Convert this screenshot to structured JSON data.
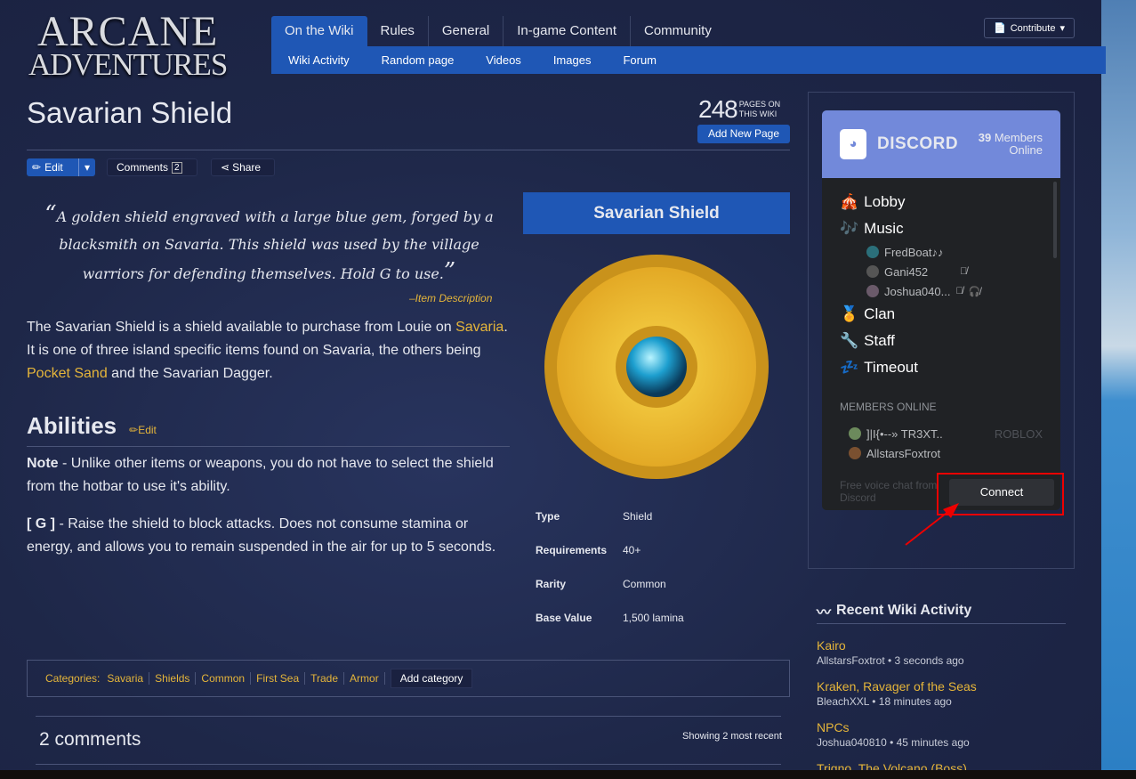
{
  "logo": {
    "line1": "ARCANE",
    "line2": "ADVENTURES"
  },
  "nav": {
    "tabs": [
      "On the Wiki",
      "Rules",
      "General",
      "In-game Content",
      "Community"
    ],
    "subtabs": [
      "Wiki Activity",
      "Random page",
      "Videos",
      "Images",
      "Forum"
    ]
  },
  "contribute": "Contribute",
  "page": {
    "title": "Savarian Shield",
    "count": "248",
    "count_label1": "PAGES ON",
    "count_label2": "THIS WIKI",
    "add_page": "Add New Page"
  },
  "actions": {
    "edit": "Edit",
    "comments": "Comments",
    "comments_count": "2",
    "share": "Share"
  },
  "quote": {
    "text": "A golden shield engraved with a large blue gem, forged by a blacksmith on Savaria. This shield was used by the village warriors for defending themselves. Hold G to use.",
    "source": "–Item Description"
  },
  "intro": {
    "p1": "The Savarian Shield is a shield available to purchase from Louie on ",
    "link1": "Savaria",
    "p2": ". It is one of three island specific items found on Savaria, the others being ",
    "link2": "Pocket Sand",
    "p3": " and the Savarian Dagger."
  },
  "abilities": {
    "title": "Abilities",
    "edit": "Edit",
    "note_label": "Note",
    "note": " - Unlike other items or weapons, you do not have to select the shield from the hotbar to use it's ability.",
    "key_label": "[ G ]",
    "key": " - Raise the shield to block attacks. Does not consume stamina or energy, and allows you to remain suspended in the air for up to 5 seconds."
  },
  "infobox": {
    "title": "Savarian Shield",
    "rows": [
      {
        "k": "Type",
        "v": "Shield"
      },
      {
        "k": "Requirements",
        "v": "40+"
      },
      {
        "k": "Rarity",
        "v": "Common"
      },
      {
        "k": "Base Value",
        "v": "1,500 lamina"
      }
    ]
  },
  "categories": {
    "label": "Categories:",
    "items": [
      "Savaria",
      "Shields",
      "Common",
      "First Sea",
      "Trade",
      "Armor"
    ],
    "add": "Add category"
  },
  "comments": {
    "title": "2 comments",
    "showing": "Showing 2 most recent"
  },
  "discord": {
    "brand": "DISCORD",
    "members_count": "39",
    "members_label": "Members",
    "online_label": "Online",
    "channels": [
      {
        "name": "Lobby",
        "icon": "🎪"
      },
      {
        "name": "Music",
        "icon": "🎶"
      }
    ],
    "music_members": [
      "FredBoat♪♪",
      "Gani452",
      "Joshua040..."
    ],
    "channels2": [
      {
        "name": "Clan",
        "icon": "🏅"
      },
      {
        "name": "Staff",
        "icon": "🔧"
      },
      {
        "name": "Timeout",
        "icon": "💤"
      }
    ],
    "members_header": "MEMBERS ONLINE",
    "members": [
      {
        "name": "]|I{•--» TR3XT..",
        "game": "ROBLOX"
      },
      {
        "name": "AllstarsFoxtrot",
        "game": ""
      }
    ],
    "footer": "Free voice chat from Discord",
    "connect": "Connect",
    "brand_color": "#7289da"
  },
  "recent": {
    "title": "Recent Wiki Activity",
    "items": [
      {
        "t": "Kairo",
        "m": "AllstarsFoxtrot • 3 seconds ago"
      },
      {
        "t": "Kraken, Ravager of the Seas",
        "m": "BleachXXL • 18 minutes ago"
      },
      {
        "t": "NPCs",
        "m": "Joshua040810 • 45 minutes ago"
      },
      {
        "t": "Trigno, The Volcano (Boss)",
        "m": ""
      }
    ]
  },
  "colors": {
    "accent": "#1f57b5",
    "link": "#e5b53a",
    "annotation": "#ee0000"
  }
}
